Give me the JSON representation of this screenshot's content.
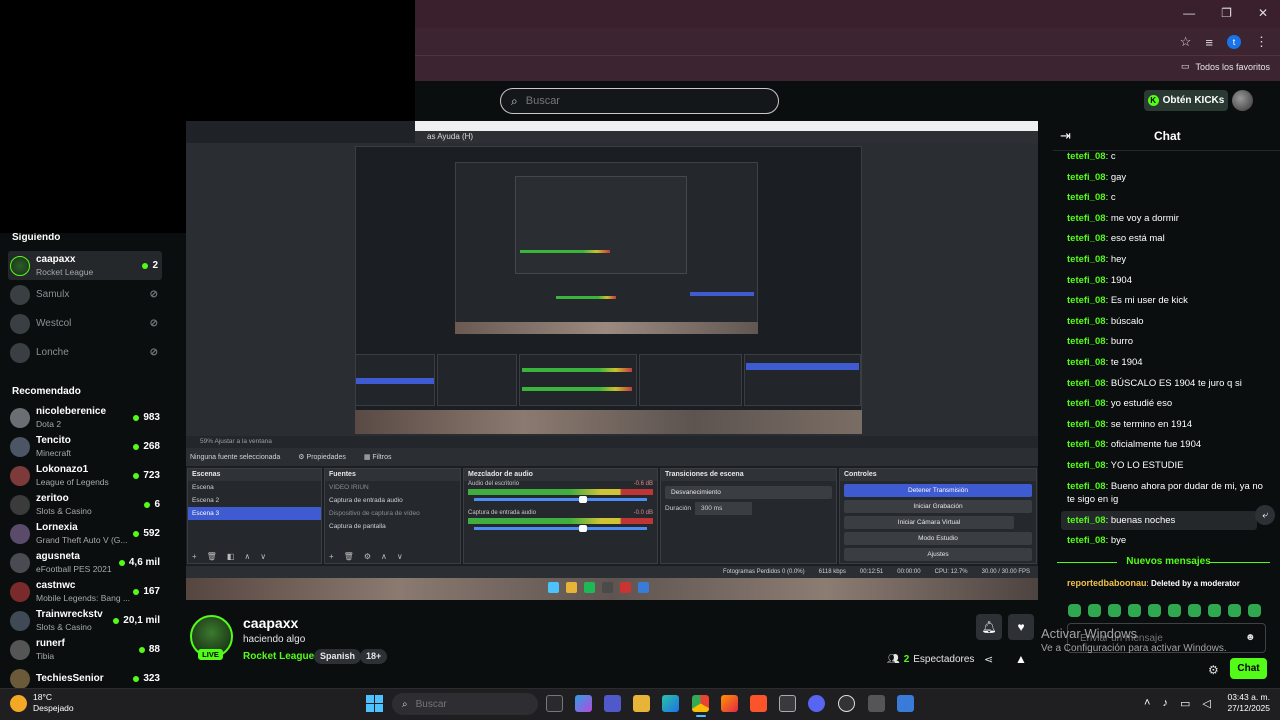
{
  "browser": {
    "window_controls": [
      "—",
      "❐",
      "✕"
    ],
    "profile_letter": "t",
    "bookmarks_all": "Todos los favoritos"
  },
  "header": {
    "search_placeholder": "Buscar",
    "kicks_button": "Obtén KICKs"
  },
  "sidebar": {
    "following_title": "Siguiendo",
    "following": [
      {
        "name": "caapaxx",
        "category": "Rocket League",
        "viewers": "2",
        "live": true
      },
      {
        "name": "Samulx",
        "category": "",
        "viewers": "",
        "live": false
      },
      {
        "name": "Westcol",
        "category": "",
        "viewers": "",
        "live": false
      },
      {
        "name": "Lonche",
        "category": "",
        "viewers": "",
        "live": false
      }
    ],
    "recommended_title": "Recomendado",
    "recommended": [
      {
        "name": "nicoleberenice",
        "category": "Dota 2",
        "viewers": "983"
      },
      {
        "name": "Tencito",
        "category": "Minecraft",
        "viewers": "268"
      },
      {
        "name": "Lokonazo1",
        "category": "League of Legends",
        "viewers": "723"
      },
      {
        "name": "zeritoo",
        "category": "Slots & Casino",
        "viewers": "6"
      },
      {
        "name": "Lornexia",
        "category": "Grand Theft Auto V (G...",
        "viewers": "592"
      },
      {
        "name": "agusneta",
        "category": "eFootball PES 2021",
        "viewers": "4,6 mil"
      },
      {
        "name": "castnwc",
        "category": "Mobile Legends: Bang ...",
        "viewers": "167"
      },
      {
        "name": "Trainwreckstv",
        "category": "Slots & Casino",
        "viewers": "20,1 mil"
      },
      {
        "name": "runerf",
        "category": "Tibia",
        "viewers": "88"
      },
      {
        "name": "TechiesSenior",
        "category": "",
        "viewers": "323"
      }
    ]
  },
  "obs": {
    "menu_text": "as   Ayuda (H)",
    "zoom_text": "59%    Ajustar a la ventana",
    "no_source": "Ninguna fuente seleccionada",
    "properties": "Propiedades",
    "filters": "Filtros",
    "scenes_title": "Escenas",
    "scenes": [
      "Escena",
      "Escena 2",
      "Escena 3"
    ],
    "sources_title": "Fuentes",
    "sources": [
      "VIDEO IRIUN",
      "Captura de entrada audio",
      "Dispositivo de captura de vídeo",
      "Captura de pantalla"
    ],
    "mixer_title": "Mezclador de audio",
    "mixer_desktop": "Audio del escritorio",
    "mixer_desktop_db": "-0.6 dB",
    "mixer_mic": "Captura de entrada audio",
    "mixer_mic_db": "-0.0 dB",
    "transitions_title": "Transiciones de escena",
    "transition_value": "Desvanecimiento",
    "duration_label": "Duración",
    "duration_value": "300 ms",
    "controls_title": "Controles",
    "controls": [
      "Detener Transmisión",
      "Iniciar Grabación",
      "Iniciar Cámara Virtual",
      "Modo Estudio",
      "Ajustes"
    ],
    "status": [
      "Fotogramas Perdidos 0 (0.0%)",
      "6118 kbps",
      "00:12:51",
      "00:00:00",
      "CPU: 12.7%",
      "30.00 / 30.00 FPS"
    ]
  },
  "stream": {
    "name": "caapaxx",
    "title": "haciendo algo",
    "category": "Rocket League",
    "tags": [
      "Spanish",
      "18+"
    ],
    "live_label": "LIVE",
    "viewers_count": "2",
    "viewers_label": "Espectadores"
  },
  "chat": {
    "title": "Chat",
    "messages": [
      {
        "user": "tetefi_08",
        "text": "c"
      },
      {
        "user": "tetefi_08",
        "text": "gay"
      },
      {
        "user": "tetefi_08",
        "text": "c"
      },
      {
        "user": "tetefi_08",
        "text": "me voy a dormir"
      },
      {
        "user": "tetefi_08",
        "text": "eso está mal"
      },
      {
        "user": "tetefi_08",
        "text": "hey"
      },
      {
        "user": "tetefi_08",
        "text": "1904"
      },
      {
        "user": "tetefi_08",
        "text": "Es mi user de kick"
      },
      {
        "user": "tetefi_08",
        "text": "búscalo"
      },
      {
        "user": "tetefi_08",
        "text": "burro"
      },
      {
        "user": "tetefi_08",
        "text": "te 1904"
      },
      {
        "user": "tetefi_08",
        "text": "BÚSCALO ES 1904 te juro q si"
      },
      {
        "user": "tetefi_08",
        "text": "yo estudié eso"
      },
      {
        "user": "tetefi_08",
        "text": "se termino en 1914"
      },
      {
        "user": "tetefi_08",
        "text": "oficialmente fue 1904"
      },
      {
        "user": "tetefi_08",
        "text": "YO LO ESTUDIE"
      },
      {
        "user": "tetefi_08",
        "text": "Bueno ahora por dudar de mi, ya no te sigo en ig"
      },
      {
        "user": "tetefi_08",
        "text": "buenas noches"
      },
      {
        "user": "tetefi_08",
        "text": "bye"
      }
    ],
    "new_messages": "Nuevos mensajes",
    "deleted_user": "reportedbaboonau",
    "deleted_text": "Deleted by a moderator",
    "input_placeholder": "Enviar un mensaje",
    "send_label": "Chat"
  },
  "windows_watermark": {
    "title": "Activar Windows",
    "subtitle": "Ve a Configuración para activar Windows."
  },
  "taskbar": {
    "temperature": "18°C",
    "weather": "Despejado",
    "search_placeholder": "Buscar",
    "time": "03:43 a. m.",
    "date": "27/12/2025",
    "weather_badge": "1"
  },
  "colors": {
    "kick_green": "#53fc18",
    "obs_blue": "#3e5bd1",
    "chrome_bar": "#3d2431"
  }
}
